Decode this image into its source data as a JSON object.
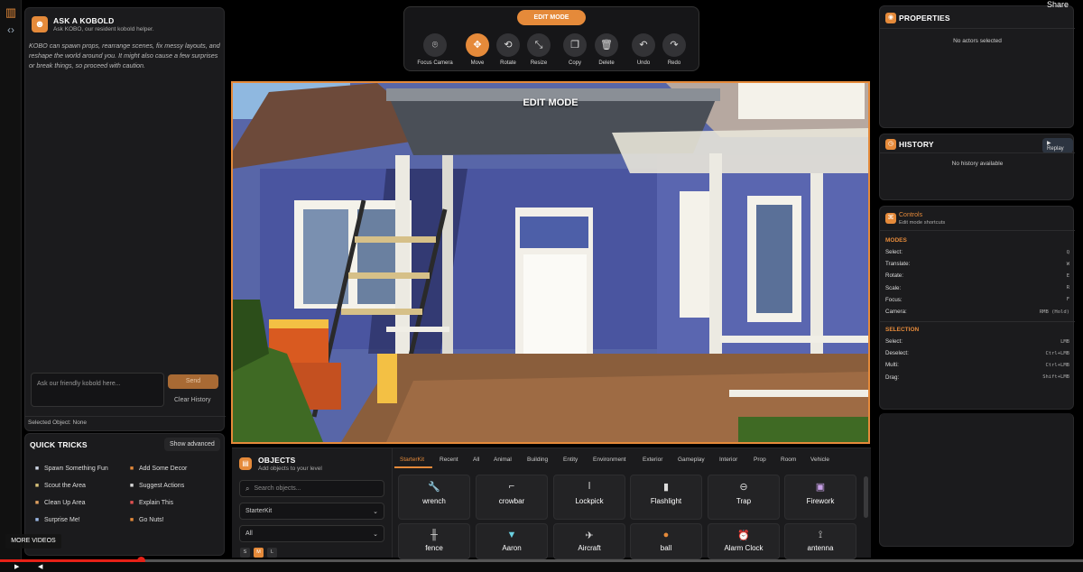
{
  "rail": {
    "map_icon": "map-icon",
    "code_icon": "code-icon"
  },
  "kobold": {
    "title": "ASK A KOBOLD",
    "subtitle": "Ask KOBO, our resident kobold helper.",
    "description": "KOBO can spawn props, rearrange scenes, fix messy layouts, and reshape the world around you. It might also cause a few surprises or break things, so proceed with caution.",
    "input_placeholder": "Ask our friendly kobold here...",
    "send_label": "Send",
    "clear_label": "Clear History",
    "selected_object": "Selected Object: None"
  },
  "tricks": {
    "title": "QUICK TRICKS",
    "show_advanced": "Show advanced",
    "items": [
      {
        "label": "Spawn Something Fun",
        "icon": "cube-icon",
        "color": "#cfd8e6"
      },
      {
        "label": "Add Some Decor",
        "icon": "plus-icon",
        "color": "#e58a3a"
      },
      {
        "label": "Scout the Area",
        "icon": "eye-icon",
        "color": "#d8c27a"
      },
      {
        "label": "Suggest Actions",
        "icon": "chat-icon",
        "color": "#d8d8d8"
      },
      {
        "label": "Clean Up Area",
        "icon": "broom-icon",
        "color": "#e0a060"
      },
      {
        "label": "Explain This",
        "icon": "question-icon",
        "color": "#e05050"
      },
      {
        "label": "Surprise Me!",
        "icon": "sparkle-icon",
        "color": "#9ab8e6"
      },
      {
        "label": "Go Nuts!",
        "icon": "nut-icon",
        "color": "#e58a3a"
      }
    ]
  },
  "toolbar": {
    "mode_label": "EDIT MODE",
    "tools": [
      {
        "label": "Focus Camera",
        "icon": "camera-icon",
        "glyph": "⌾"
      },
      {
        "label": "Move",
        "icon": "move-icon",
        "glyph": "✥"
      },
      {
        "label": "Rotate",
        "icon": "rotate-icon",
        "glyph": "⟲"
      },
      {
        "label": "Resize",
        "icon": "resize-icon",
        "glyph": "⤡"
      },
      {
        "label": "Copy",
        "icon": "copy-icon",
        "glyph": "❐"
      },
      {
        "label": "Delete",
        "icon": "trash-icon",
        "glyph": "🗑"
      },
      {
        "label": "Undo",
        "icon": "undo-icon",
        "glyph": "↶"
      },
      {
        "label": "Redo",
        "icon": "redo-icon",
        "glyph": "↷"
      }
    ],
    "active_tool": "Move"
  },
  "viewport": {
    "label": "EDIT MODE"
  },
  "properties": {
    "title": "PROPERTIES",
    "empty": "No actors selected"
  },
  "history": {
    "title": "HISTORY",
    "replay": "Replay",
    "empty": "No history available"
  },
  "controls": {
    "title": "Controls",
    "subtitle": "Edit mode shortcuts",
    "modes_title": "MODES",
    "modes": [
      {
        "label": "Select:",
        "key": "Q"
      },
      {
        "label": "Translate:",
        "key": "W"
      },
      {
        "label": "Rotate:",
        "key": "E"
      },
      {
        "label": "Scale:",
        "key": "R"
      },
      {
        "label": "Focus:",
        "key": "F"
      },
      {
        "label": "Camera:",
        "key": "RMB (Hold)"
      }
    ],
    "selection_title": "SELECTION",
    "selection": [
      {
        "label": "Select:",
        "key": "LMB"
      },
      {
        "label": "Deselect:",
        "key": "Ctrl+LMB"
      },
      {
        "label": "Multi:",
        "key": "Ctrl+LMB"
      },
      {
        "label": "Drag:",
        "key": "Shift+LMB"
      }
    ]
  },
  "objects": {
    "title": "OBJECTS",
    "subtitle": "Add objects to your level",
    "search_placeholder": "Search objects...",
    "kit_value": "StarterKit",
    "filter_value": "All",
    "sizes": [
      "S",
      "M",
      "L"
    ],
    "selected_size": "M",
    "tabs": [
      "StarterKit",
      "Recent",
      "All",
      "Animal",
      "Building",
      "Entity",
      "Environment",
      "Exterior",
      "Gameplay",
      "Interior",
      "Prop",
      "Room",
      "Vehicle"
    ],
    "selected_tab": "StarterKit",
    "items": [
      {
        "label": "wrench",
        "icon": "wrench-icon",
        "glyph": "🔧"
      },
      {
        "label": "crowbar",
        "icon": "crowbar-icon",
        "glyph": "⌐"
      },
      {
        "label": "Lockpick",
        "icon": "lockpick-icon",
        "glyph": "ǀ"
      },
      {
        "label": "Flashlight",
        "icon": "flashlight-icon",
        "glyph": "▮"
      },
      {
        "label": "Trap",
        "icon": "trap-icon",
        "glyph": "⊖"
      },
      {
        "label": "Firework",
        "icon": "firework-icon",
        "glyph": "▣"
      },
      {
        "label": "fence",
        "icon": "fence-icon",
        "glyph": "╫"
      },
      {
        "label": "Aaron",
        "icon": "aaron-icon",
        "glyph": "▼"
      },
      {
        "label": "Aircraft",
        "icon": "aircraft-icon",
        "glyph": "✈"
      },
      {
        "label": "ball",
        "icon": "ball-icon",
        "glyph": "●"
      },
      {
        "label": "Alarm Clock",
        "icon": "alarm-clock-icon",
        "glyph": "⏰"
      },
      {
        "label": "antenna",
        "icon": "antenna-icon",
        "glyph": "⟟"
      }
    ]
  },
  "video": {
    "more_videos": "MORE VIDEOS",
    "share": "Share",
    "progress": 0.13
  },
  "colors": {
    "accent": "#e58a3a",
    "panel": "#1b1b1d",
    "background": "#000000"
  }
}
